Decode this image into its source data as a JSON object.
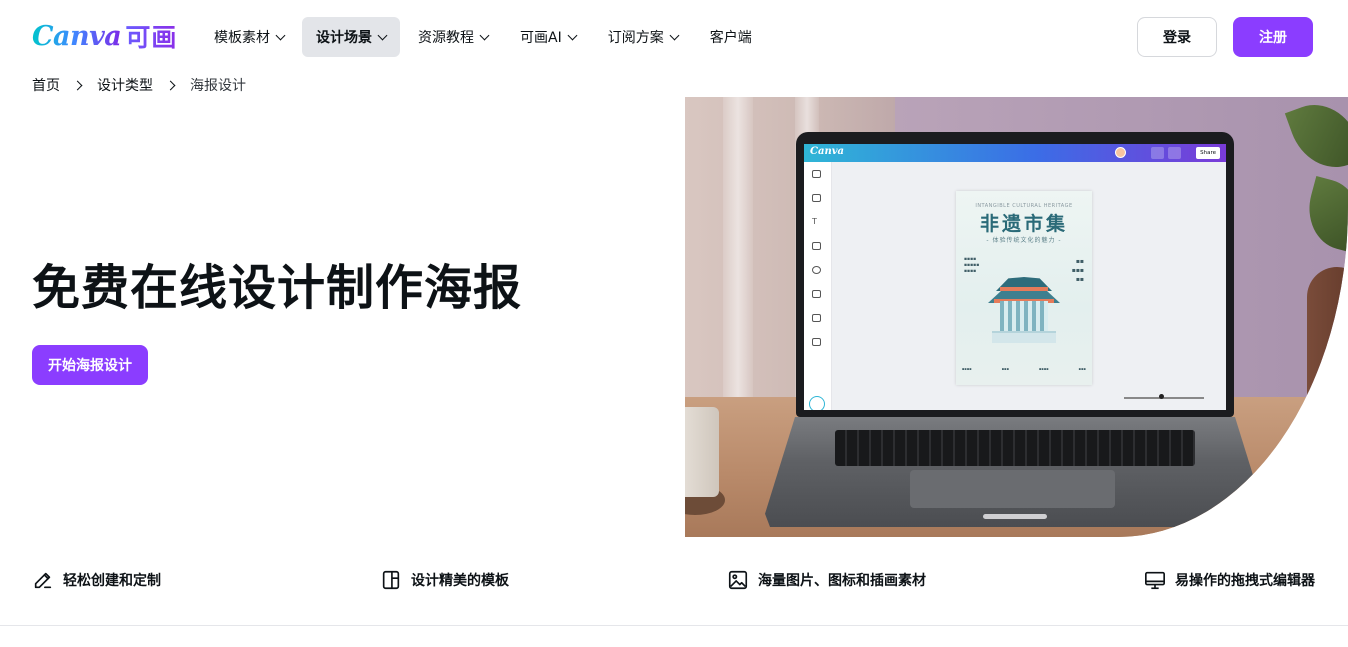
{
  "header": {
    "logo_en": "Canva",
    "logo_cn": "可画",
    "nav": [
      {
        "label": "模板素材",
        "has_dropdown": true,
        "active": false
      },
      {
        "label": "设计场景",
        "has_dropdown": true,
        "active": true
      },
      {
        "label": "资源教程",
        "has_dropdown": true,
        "active": false
      },
      {
        "label": "可画AI",
        "has_dropdown": true,
        "active": false
      },
      {
        "label": "订阅方案",
        "has_dropdown": true,
        "active": false
      },
      {
        "label": "客户端",
        "has_dropdown": false,
        "active": false
      }
    ],
    "login_label": "登录",
    "register_label": "注册"
  },
  "breadcrumb": [
    "首页",
    "设计类型",
    "海报设计"
  ],
  "hero": {
    "title": "免费在线设计制作海报",
    "cta_label": "开始海报设计",
    "mockup": {
      "app_logo": "Canva",
      "share_label": "Share",
      "poster": {
        "title": "非遗市集",
        "subtitle": "- 体验传统文化的魅力 -"
      }
    }
  },
  "features": [
    {
      "icon": "pencil-icon",
      "label": "轻松创建和定制"
    },
    {
      "icon": "template-layout-icon",
      "label": "设计精美的模板"
    },
    {
      "icon": "image-icon",
      "label": "海量图片、图标和插画素材"
    },
    {
      "icon": "monitor-icon",
      "label": "易操作的拖拽式编辑器"
    }
  ],
  "colors": {
    "brand_purple": "#8b3dff",
    "nav_active_bg": "#e3e5e9",
    "text": "#0d1216"
  }
}
